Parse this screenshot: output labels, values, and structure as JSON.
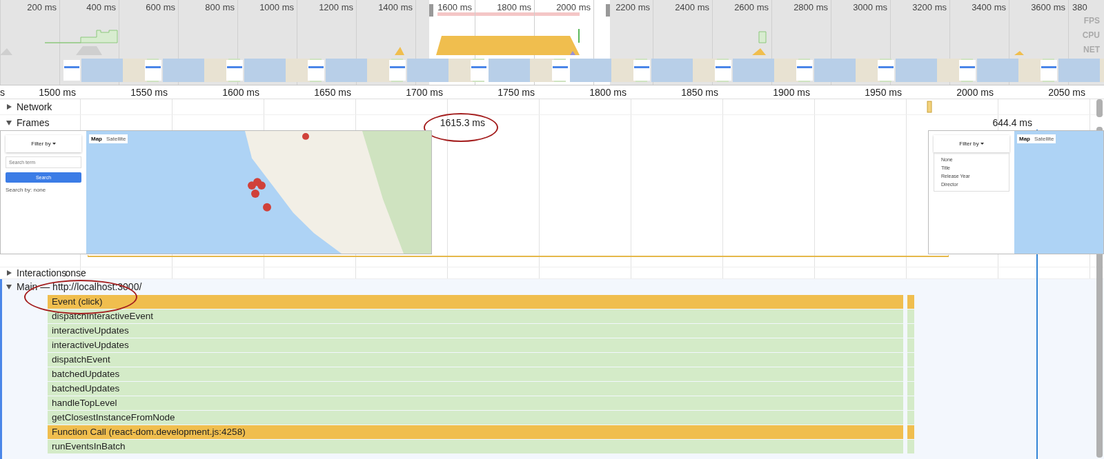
{
  "overview": {
    "ticks": [
      "200 ms",
      "400 ms",
      "600 ms",
      "800 ms",
      "1000 ms",
      "1200 ms",
      "1400 ms",
      "1600 ms",
      "1800 ms",
      "2000 ms",
      "2200 ms",
      "2400 ms",
      "2600 ms",
      "2800 ms",
      "3000 ms",
      "3200 ms",
      "3400 ms",
      "3600 ms"
    ],
    "cut_tick": "380",
    "lanes": [
      "FPS",
      "CPU",
      "NET"
    ]
  },
  "ruler": {
    "cut_tick": "s",
    "ticks": [
      "1500 ms",
      "1550 ms",
      "1600 ms",
      "1650 ms",
      "1700 ms",
      "1750 ms",
      "1800 ms",
      "1850 ms",
      "1900 ms",
      "1950 ms",
      "2000 ms",
      "2050 ms"
    ]
  },
  "network": {
    "title": "Network",
    "expanded": false
  },
  "frames": {
    "title": "Frames",
    "expanded": true,
    "items": [
      {
        "duration": "1615.3 ms",
        "filter_button": "Filter by",
        "search_placeholder": "Search term",
        "search_button": "Search",
        "status": "Search by: none",
        "map_buttons": [
          "Map",
          "Satellite"
        ]
      },
      {
        "duration": "644.4 ms",
        "filter_button": "Filter by",
        "menu": [
          "None",
          "Title",
          "Release Year",
          "Director"
        ],
        "map_buttons": [
          "Map",
          "Satellite"
        ]
      }
    ]
  },
  "interactions": {
    "title": "Interactions",
    "expanded": false,
    "hidden_label": "onse"
  },
  "main": {
    "title": "Main — http://localhost:3000/",
    "expanded": true,
    "entries": [
      {
        "name": "Event (click)",
        "kind": "event"
      },
      {
        "name": "dispatchInteractiveEvent",
        "kind": "function"
      },
      {
        "name": "interactiveUpdates",
        "kind": "function"
      },
      {
        "name": "interactiveUpdates",
        "kind": "function"
      },
      {
        "name": "dispatchEvent",
        "kind": "function"
      },
      {
        "name": "batchedUpdates",
        "kind": "function"
      },
      {
        "name": "batchedUpdates",
        "kind": "function"
      },
      {
        "name": "handleTopLevel",
        "kind": "function"
      },
      {
        "name": "getClosestInstanceFromNode",
        "kind": "function"
      },
      {
        "name": "Function Call (react-dom.development.js:4258)",
        "kind": "event"
      },
      {
        "name": "runEventsInBatch",
        "kind": "function"
      }
    ]
  }
}
